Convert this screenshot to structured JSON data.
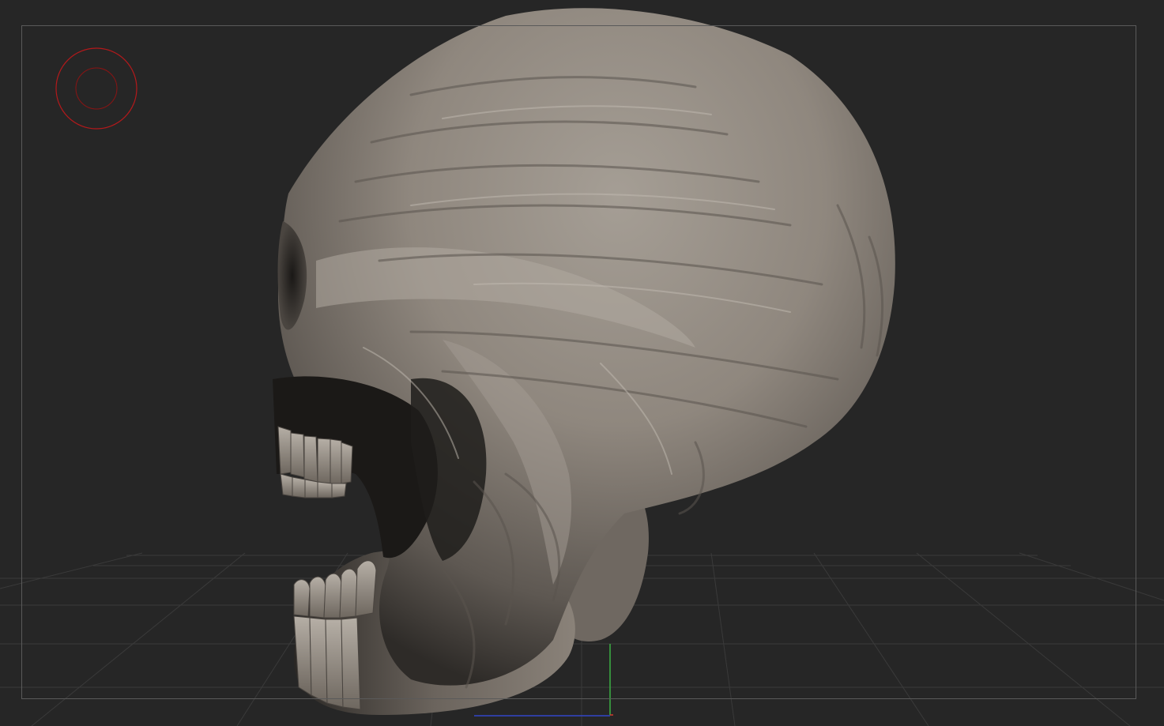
{
  "viewport": {
    "background": "#262626",
    "grid_color": "#3a3a3a",
    "frame_color": "#5a5a5a",
    "model": "sculpted-skull-mesh",
    "model_color": "#8c857d"
  },
  "brush_cursor": {
    "icon": "brush-circle-icon",
    "color": "#b3191b"
  },
  "gizmo": {
    "axis_y_color": "#3cb043",
    "axis_x_color": "#d23b2b",
    "axis_z_color": "#3246c8"
  }
}
